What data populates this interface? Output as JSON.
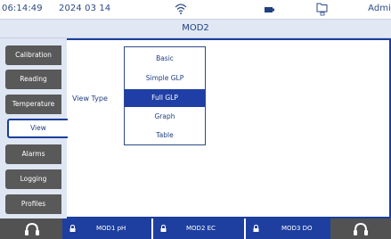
{
  "status": {
    "time": "06:14:49",
    "date": "2024 03 14",
    "user": "Admi",
    "icons": [
      "wifi-icon",
      "battery-icon",
      "folder-usb-icon"
    ]
  },
  "title": "MOD2",
  "sidebar": {
    "tabs": [
      {
        "label": "Calibration",
        "active": false
      },
      {
        "label": "Reading",
        "active": false
      },
      {
        "label": "Temperature",
        "active": false
      },
      {
        "label": "View",
        "active": true
      },
      {
        "label": "Alarms",
        "active": false
      },
      {
        "label": "Logging",
        "active": false
      },
      {
        "label": "Profiles",
        "active": false
      }
    ]
  },
  "main": {
    "field_label": "View Type",
    "options": [
      "Basic",
      "Simple GLP",
      "Full GLP",
      "Graph",
      "Table"
    ],
    "selected": "Full GLP"
  },
  "bottom": {
    "modules": [
      {
        "label": "MOD1 pH"
      },
      {
        "label": "MOD2 EC"
      },
      {
        "label": "MOD3 DO"
      }
    ],
    "icons": [
      "headphones-icon",
      "lock-icon"
    ]
  },
  "colors": {
    "accent": "#1e3f9f",
    "text": "#1f3f80",
    "tab": "#595959",
    "panel": "#dfe6f3"
  }
}
